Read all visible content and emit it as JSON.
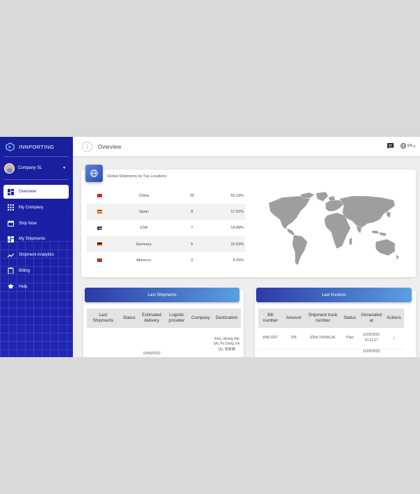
{
  "brand": {
    "name": "INNPORTING"
  },
  "user": {
    "name": "Company SL"
  },
  "nav": [
    {
      "label": "Overview",
      "icon": "dashboard-icon",
      "active": true
    },
    {
      "label": "My Company",
      "icon": "apps-icon"
    },
    {
      "label": "Ship Now",
      "icon": "calendar-icon"
    },
    {
      "label": "My Shipments",
      "icon": "dashboard-icon"
    },
    {
      "label": "Shipment Analytics",
      "icon": "trending-icon"
    },
    {
      "label": "Billing",
      "icon": "clipboard-icon"
    },
    {
      "label": "Help",
      "icon": "school-icon"
    }
  ],
  "topbar": {
    "title": "Overview",
    "language": "EN"
  },
  "locations": {
    "title": "Global Shipments by Top Locations",
    "rows": [
      {
        "country": "China",
        "count": "25",
        "percent": "53.19%",
        "flag": "cn"
      },
      {
        "country": "Spain",
        "count": "8",
        "percent": "17.02%",
        "flag": "es"
      },
      {
        "country": "USA",
        "count": "7",
        "percent": "14.89%",
        "flag": "us"
      },
      {
        "country": "Germany",
        "count": "5",
        "percent": "10.63%",
        "flag": "de"
      },
      {
        "country": "Morocco",
        "count": "2",
        "percent": "4.25%",
        "flag": "ma"
      }
    ]
  },
  "shipments": {
    "title": "Last Shipments",
    "columns": [
      "Last Shipments",
      "Status",
      "Estimated delivery",
      "Logistic provider",
      "Company",
      "Destination"
    ],
    "row": {
      "date": "10/06/2022",
      "destination": "Xina, Shang Hai Shi, Pu Dong Xin Qu, 陆家嘴"
    }
  },
  "invoices": {
    "title": "Last Invoices",
    "columns": [
      "Bill number",
      "Amount",
      "Shipment track number",
      "Status",
      "Generated at",
      "Actions"
    ],
    "rows": [
      {
        "bill": "INN-0237",
        "amount": "206",
        "track": "iZReLY/AUbCsK",
        "status": "Paid",
        "generated": "11/05/2022 10:12:27"
      },
      {
        "bill": "",
        "amount": "",
        "track": "",
        "status": "",
        "generated": "11/05/2022"
      }
    ]
  },
  "colors": {
    "sidebar": "#1b1fa8",
    "accent": "#3a6fd8"
  }
}
